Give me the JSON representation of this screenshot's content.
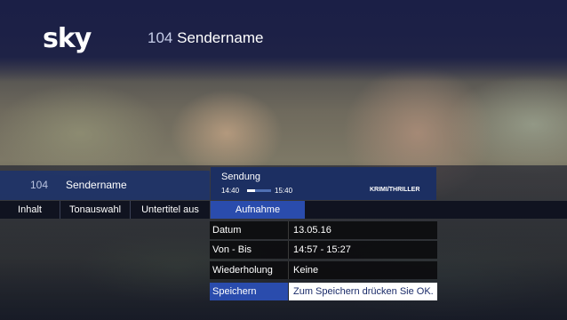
{
  "header": {
    "logo": "sky",
    "channel_number": "104",
    "channel_name": "Sendername"
  },
  "info_bar": {
    "channel_number": "104",
    "channel_name": "Sendername",
    "program_title": "Sendung",
    "start_time": "14:40",
    "end_time": "15:40",
    "progress": 0.35,
    "genre": "KRIMI/THRILLER"
  },
  "menu": {
    "items": [
      {
        "label": "Inhalt"
      },
      {
        "label": "Tonauswahl"
      },
      {
        "label": "Untertitel aus"
      },
      {
        "label": "Aufnahme",
        "active": true
      }
    ]
  },
  "recording_panel": {
    "rows": [
      {
        "label": "Datum",
        "value": "13.05.16"
      },
      {
        "label": "Von - Bis",
        "value": "14:57 - 15:27"
      },
      {
        "label": "Wiederholung",
        "value": "Keine"
      },
      {
        "label": "Speichern",
        "value": "Zum Speichern drücken Sie OK."
      }
    ]
  },
  "colors": {
    "accent": "#2a4cad",
    "info_bar": "#1b2f64",
    "header": "#1b1f46"
  }
}
